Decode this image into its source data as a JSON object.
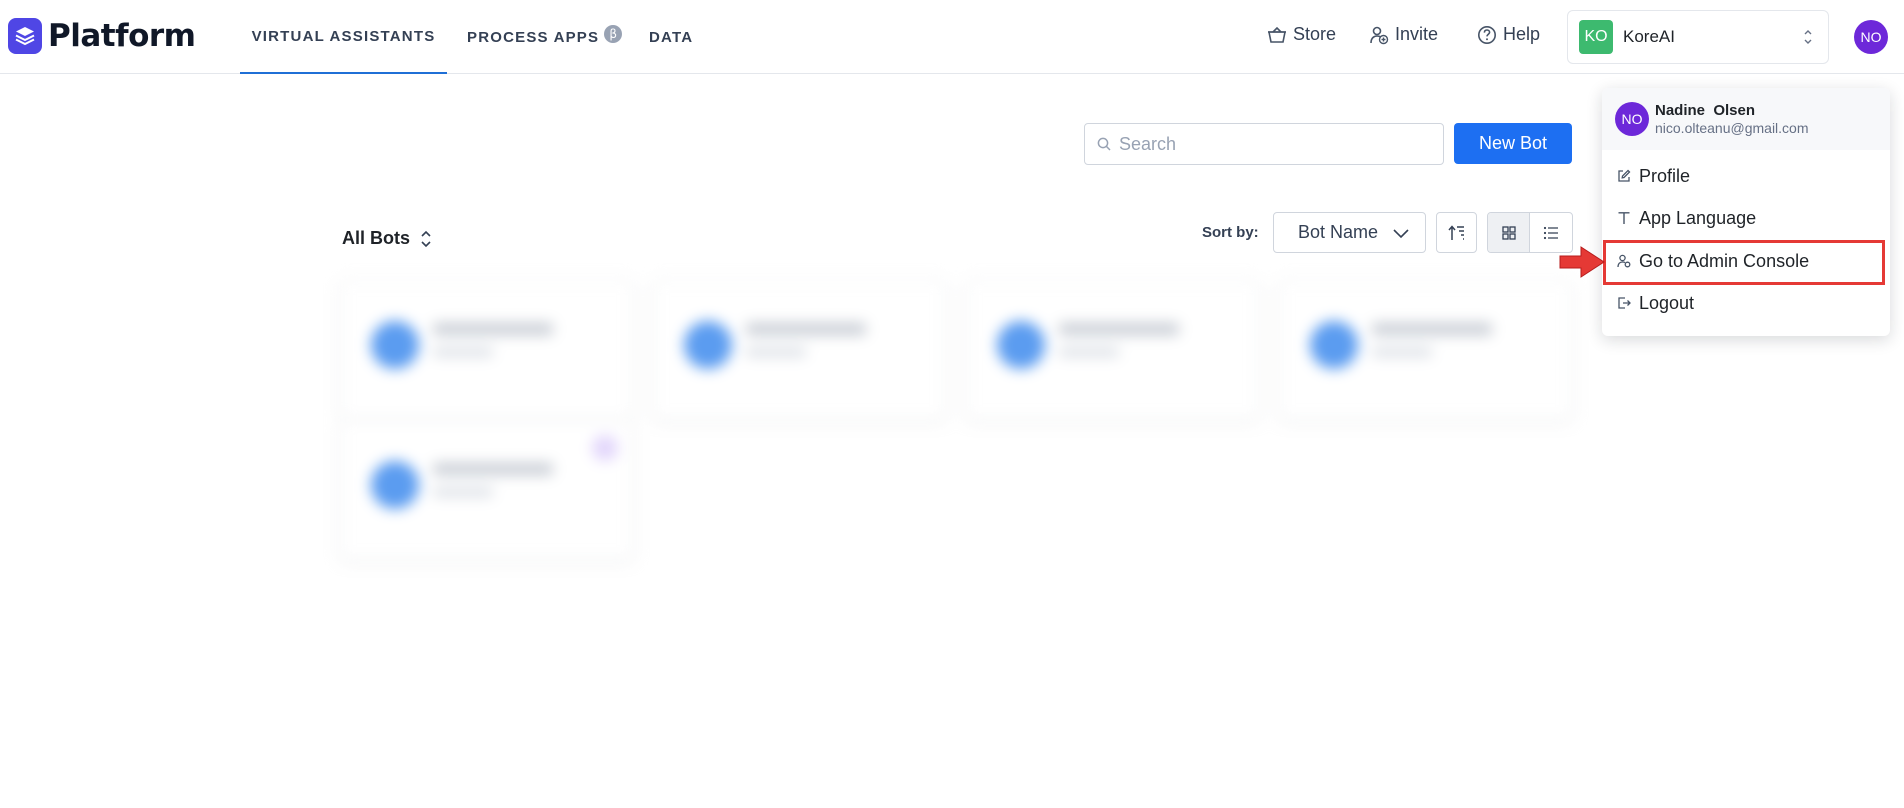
{
  "app": {
    "name": "Platform"
  },
  "nav": {
    "tabs": [
      {
        "label": "VIRTUAL ASSISTANTS",
        "active": true
      },
      {
        "label": "PROCESS APPS",
        "badge": "β"
      },
      {
        "label": "DATA"
      }
    ]
  },
  "header": {
    "store_label": "Store",
    "invite_label": "Invite",
    "help_label": "Help",
    "account": {
      "initials": "KO",
      "name": "KoreAI",
      "color": "#3dba6f"
    },
    "user_initials": "NO",
    "avatar_color": "#6d28d9"
  },
  "toolbar": {
    "search_placeholder": "Search",
    "new_bot_label": "New Bot",
    "filter_label": "All Bots",
    "sort_by_label": "Sort by:",
    "sort_value": "Bot Name",
    "view_mode": "grid"
  },
  "user_menu": {
    "initials": "NO",
    "name": "Nadine  Olsen",
    "email": "nico.olteanu@gmail.com",
    "items": [
      {
        "label": "Profile",
        "icon": "edit-icon"
      },
      {
        "label": "App Language",
        "icon": "text-icon"
      },
      {
        "label": "Go to Admin Console",
        "icon": "admin-user-icon",
        "highlighted": true
      },
      {
        "label": "Logout",
        "icon": "logout-icon"
      }
    ]
  },
  "colors": {
    "accent": "#1d6ff2",
    "brand": "#4f46e5",
    "highlight": "#e53935"
  }
}
